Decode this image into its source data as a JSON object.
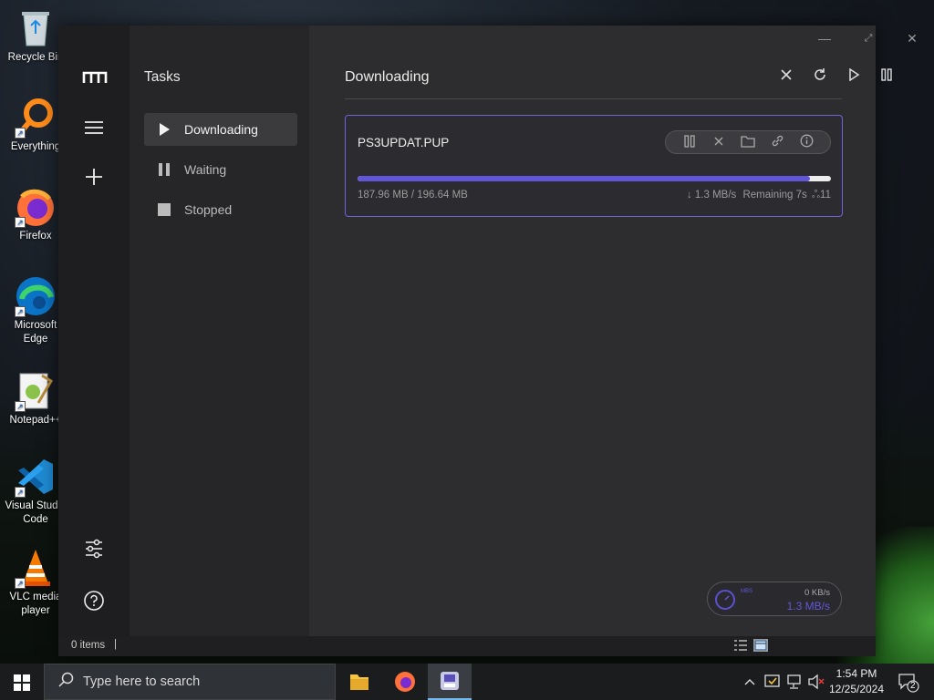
{
  "desktop": {
    "icons": [
      {
        "label": "Recycle Bin",
        "icon": "recycle-bin-icon"
      },
      {
        "label": "Everything",
        "icon": "everything-search-icon"
      },
      {
        "label": "Firefox",
        "icon": "firefox-icon"
      },
      {
        "label": "Microsoft Edge",
        "icon": "edge-icon"
      },
      {
        "label": "Notepad++",
        "icon": "notepadpp-icon"
      },
      {
        "label": "Visual Studio Code",
        "icon": "vscode-icon"
      },
      {
        "label": "VLC media player",
        "icon": "vlc-icon"
      }
    ]
  },
  "app": {
    "sidebar": {
      "title": "Tasks",
      "items": [
        {
          "label": "Downloading",
          "icon": "play-icon",
          "active": true
        },
        {
          "label": "Waiting",
          "icon": "pause-icon",
          "active": false
        },
        {
          "label": "Stopped",
          "icon": "stop-icon",
          "active": false
        }
      ]
    },
    "main": {
      "title": "Downloading",
      "toolbar": [
        "close-icon",
        "refresh-icon",
        "play-icon",
        "pause-icon"
      ]
    },
    "download": {
      "filename": "PS3UPDAT.PUP",
      "progress": 0.956,
      "size_text": "187.96 MB / 196.64 MB",
      "speed": "1.3 MB/s",
      "remaining": "Remaining 7s",
      "connections": "11",
      "actions": [
        "pause-icon",
        "close-icon",
        "folder-icon",
        "link-icon",
        "info-icon"
      ]
    },
    "speed_widget": {
      "label": "MBS",
      "upload": "0 KB/s",
      "download": "1.3 MB/s"
    },
    "status": {
      "items": "0 items",
      "caret": "|"
    },
    "accent": "#6256d8"
  },
  "taskbar": {
    "search_placeholder": "Type here to search",
    "time": "1:54 PM",
    "date": "12/25/2024",
    "notifications": "2"
  }
}
